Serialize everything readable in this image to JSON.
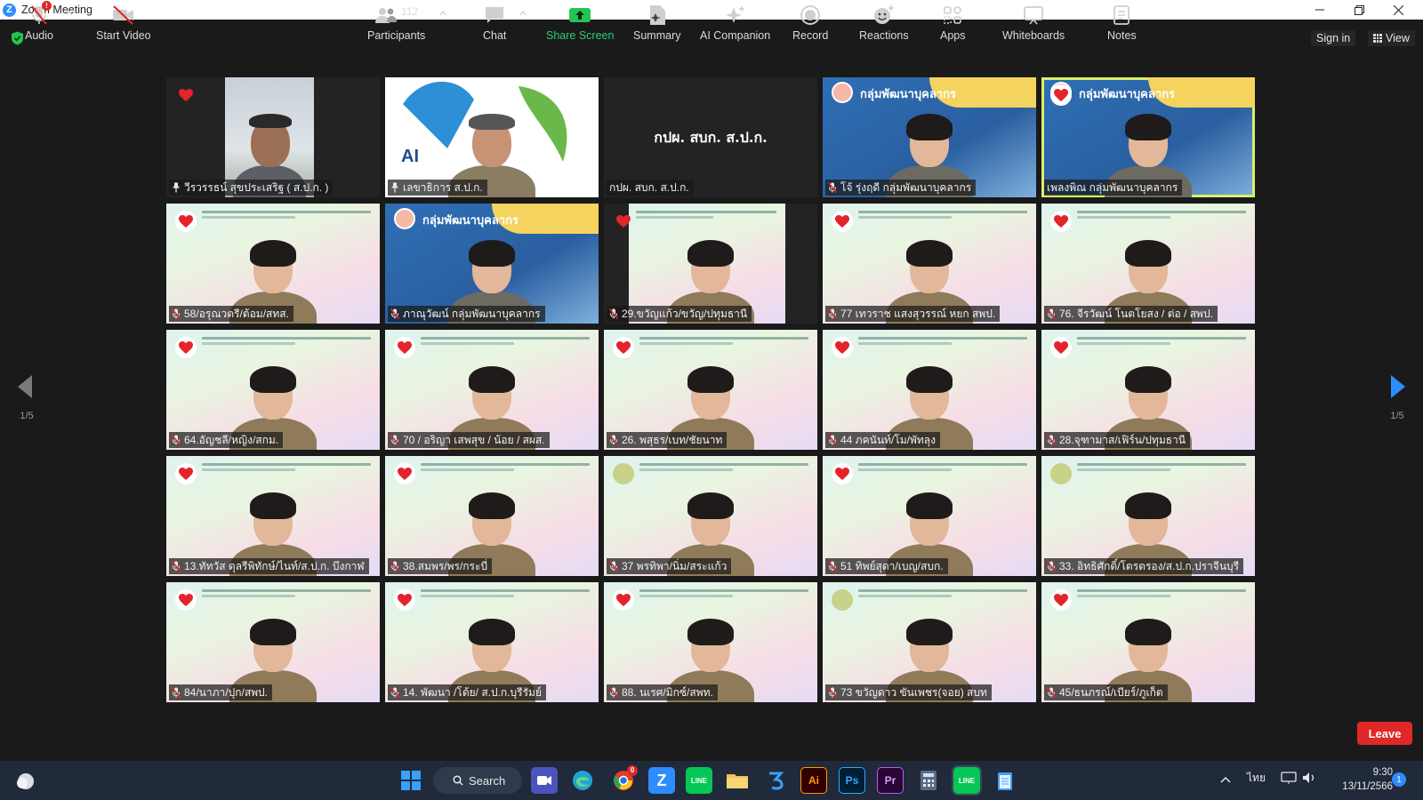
{
  "window": {
    "title": "Zoom Meeting"
  },
  "topbar": {
    "sign_in": "Sign in",
    "view": "View"
  },
  "pagination": {
    "left_label": "1/5",
    "right_label": "1/5"
  },
  "participants": [
    {
      "name": "วีรวรรธน์ สุขประเสริฐ ( ส.ป.ก. )",
      "bg": "photo",
      "icon": "pin",
      "heart": "plain"
    },
    {
      "name": "เลขาธิการ ส.ป.ก.",
      "bg": "logo",
      "icon": "pin",
      "heart": "none"
    },
    {
      "name": "กปผ. สบก. ส.ป.ก.",
      "bg": "dark",
      "icon": "none",
      "heart": "none",
      "center_text": "กปผ. สบก. ส.ป.ก."
    },
    {
      "name": "โจ้ รุ่งฤดี กลุ่มพัฒนาบุคลากร",
      "bg": "blue",
      "icon": "mute",
      "heart": "none",
      "header": "กลุ่มพัฒนาบุคลากร"
    },
    {
      "name": "เพลงพิณ กลุ่มพัฒนาบุคลากร",
      "bg": "blue",
      "icon": "none",
      "heart": "white",
      "header": "กลุ่มพัฒนาบุคลากร",
      "active": true
    },
    {
      "name": "58/อรุณวตรี/ต้อม/สทส.",
      "bg": "pastel",
      "icon": "mute",
      "heart": "white"
    },
    {
      "name": "ภาณุวัฒน์ กลุ่มพัฒนาบุคลากร",
      "bg": "blue",
      "icon": "mute",
      "heart": "none",
      "header": "กลุ่มพัฒนาบุคลากร"
    },
    {
      "name": "29.ขวัญแก้ว/ขวัญ/ปทุมธานี",
      "bg": "pastel-narrow",
      "icon": "mute",
      "heart": "plain"
    },
    {
      "name": "77 เทวราช แสงสุวรรณ์ หยก สพป.",
      "bg": "pastel",
      "icon": "mute",
      "heart": "white"
    },
    {
      "name": "76. จีรวัฒน์ โนตโยสง / ต่อ / สพป.",
      "bg": "pastel",
      "icon": "mute",
      "heart": "white"
    },
    {
      "name": "64.อัญชลี/หญิง/สกม.",
      "bg": "pastel",
      "icon": "mute",
      "heart": "white"
    },
    {
      "name": "70 / อริญา เสพสุข / น้อย / สผส.",
      "bg": "pastel",
      "icon": "mute",
      "heart": "white"
    },
    {
      "name": "26. พสุธร/เบท/ชัยนาท",
      "bg": "pastel",
      "icon": "mute",
      "heart": "white"
    },
    {
      "name": "44 ภคนันท์/โม/พัทลุง",
      "bg": "pastel",
      "icon": "mute",
      "heart": "white"
    },
    {
      "name": "28.จุฑามาส/เฟิร์น/ปทุมธานี",
      "bg": "pastel",
      "icon": "mute",
      "heart": "white"
    },
    {
      "name": "13.ทัทวัส ดุลรีพิทักษ์/ไนท์/ส.ป.ก. บึงกาฬ",
      "bg": "pastel",
      "icon": "mute",
      "heart": "white"
    },
    {
      "name": "38.สมพร/พร/กระบี่",
      "bg": "pastel",
      "icon": "mute",
      "heart": "white"
    },
    {
      "name": "37 พรทิพา/นิ่ม/สระแก้ว",
      "bg": "pastel",
      "icon": "mute",
      "heart": "green"
    },
    {
      "name": "51 ทิพย์สุดา/เบญ/สบก.",
      "bg": "pastel",
      "icon": "mute",
      "heart": "white"
    },
    {
      "name": "33. อิทธิศักดิ์/โตรตรอง/ส.ป.ก.ปราจีนบุรี",
      "bg": "pastel",
      "icon": "mute",
      "heart": "green"
    },
    {
      "name": "84/นาภา/ปุก/สพป.",
      "bg": "pastel",
      "icon": "mute",
      "heart": "white"
    },
    {
      "name": "14. พัฒนา /โต้ย/ ส.ป.ก.บุรีรัมย์",
      "bg": "pastel",
      "icon": "mute",
      "heart": "white"
    },
    {
      "name": "88. นเรศ/มิกซ์/สพท.",
      "bg": "pastel",
      "icon": "mute",
      "heart": "white"
    },
    {
      "name": "73 ขวัญดาว ขันเพชร(จอย) สบท",
      "bg": "pastel",
      "icon": "mute",
      "heart": "green"
    },
    {
      "name": "45/ธนภรณ์/เบียร์/ภูเก็ต",
      "bg": "pastel",
      "icon": "mute",
      "heart": "white"
    }
  ],
  "toolbar": {
    "audio": "Audio",
    "start_video": "Start Video",
    "participants": "Participants",
    "participants_count": "112",
    "chat": "Chat",
    "share_screen": "Share Screen",
    "summary": "Summary",
    "ai_companion": "AI Companion",
    "record": "Record",
    "reactions": "Reactions",
    "apps": "Apps",
    "whiteboards": "Whiteboards",
    "notes": "Notes",
    "leave": "Leave",
    "audio_alert": "!"
  },
  "taskbar": {
    "search": "Search",
    "language": "ไทย",
    "time": "9:30",
    "date": "13/11/2566",
    "notification_count": "1",
    "chrome_badge": "0",
    "app_ai": "Ai",
    "app_ps": "Ps",
    "app_pr": "Pr",
    "app_line": "LINE"
  },
  "colors": {
    "accent": "#2d8cff",
    "share_green": "#2ecc71",
    "leave_red": "#e02828",
    "active_border": "#d9f06a"
  }
}
